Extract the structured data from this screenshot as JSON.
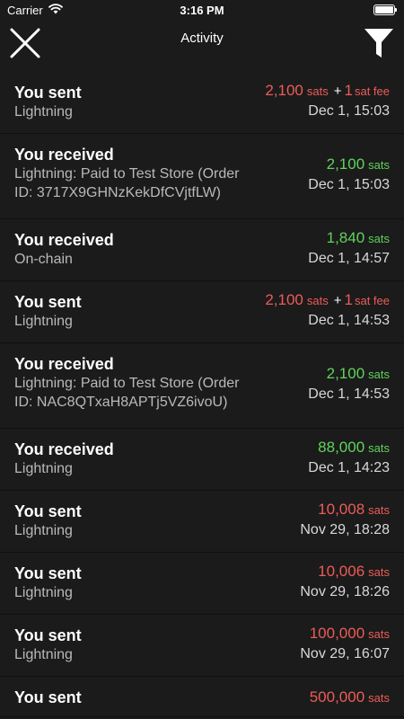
{
  "status_bar": {
    "carrier": "Carrier",
    "time": "3:16 PM"
  },
  "nav": {
    "title": "Activity"
  },
  "transactions": [
    {
      "title": "You sent",
      "subtitle": "Lightning",
      "direction": "sent",
      "amount": "2,100",
      "unit": "sats",
      "fee_amount": "1",
      "fee_unit": "sat fee",
      "date": "Dec 1, 15:03"
    },
    {
      "title": "You received",
      "subtitle": "Lightning: Paid to Test Store  (Order ID: 3717X9GHNzKekDfCVjtfLW)",
      "direction": "received",
      "amount": "2,100",
      "unit": "sats",
      "date": "Dec 1, 15:03"
    },
    {
      "title": "You received",
      "subtitle": "On-chain",
      "direction": "received",
      "amount": "1,840",
      "unit": "sats",
      "date": "Dec 1, 14:57"
    },
    {
      "title": "You sent",
      "subtitle": "Lightning",
      "direction": "sent",
      "amount": "2,100",
      "unit": "sats",
      "fee_amount": "1",
      "fee_unit": "sat fee",
      "date": "Dec 1, 14:53"
    },
    {
      "title": "You received",
      "subtitle": "Lightning: Paid to Test Store  (Order ID: NAC8QTxaH8APTj5VZ6ivoU)",
      "direction": "received",
      "amount": "2,100",
      "unit": "sats",
      "date": "Dec 1, 14:53"
    },
    {
      "title": "You received",
      "subtitle": "Lightning",
      "direction": "received",
      "amount": "88,000",
      "unit": "sats",
      "date": "Dec 1, 14:23"
    },
    {
      "title": "You sent",
      "subtitle": "Lightning",
      "direction": "sent",
      "amount": "10,008",
      "unit": "sats",
      "date": "Nov 29, 18:28"
    },
    {
      "title": "You sent",
      "subtitle": "Lightning",
      "direction": "sent",
      "amount": "10,006",
      "unit": "sats",
      "date": "Nov 29, 18:26"
    },
    {
      "title": "You sent",
      "subtitle": "Lightning",
      "direction": "sent",
      "amount": "100,000",
      "unit": "sats",
      "date": "Nov 29, 16:07"
    },
    {
      "title": "You sent",
      "subtitle": "",
      "direction": "sent",
      "amount": "500,000",
      "unit": "sats",
      "date": ""
    }
  ],
  "colors": {
    "background": "#1b1b1c",
    "sent": "#ec5c57",
    "received": "#5fd35a",
    "subtitle": "#b9b9bb"
  },
  "icons": {
    "close": "close-icon",
    "filter": "filter-icon",
    "wifi": "wifi-icon",
    "battery": "battery-icon"
  }
}
